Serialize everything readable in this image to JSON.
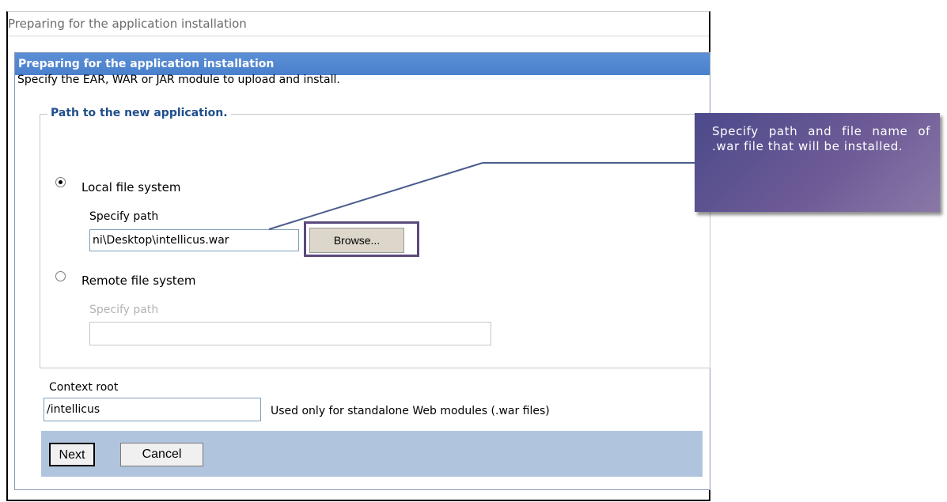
{
  "page_title": "Preparing for the application installation",
  "panel": {
    "header": "Preparing for the application installation",
    "intro": "Specify the EAR, WAR or JAR module to upload and install.",
    "fieldset_legend": "Path to the new application.",
    "local": {
      "label": "Local file system",
      "selected": true,
      "path_label": "Specify path",
      "path_value": "ni\\Desktop\\intellicus.war",
      "browse_label": "Browse..."
    },
    "remote": {
      "label": "Remote file system",
      "selected": false,
      "path_label": "Specify path",
      "path_value": ""
    },
    "context_root": {
      "label": "Context root",
      "value": "/intellicus",
      "hint": "Used only for standalone Web modules (.war files)"
    },
    "buttons": {
      "next": "Next",
      "cancel": "Cancel"
    }
  },
  "callout": {
    "text": "Specify path and file name of .war file that will be installed."
  }
}
